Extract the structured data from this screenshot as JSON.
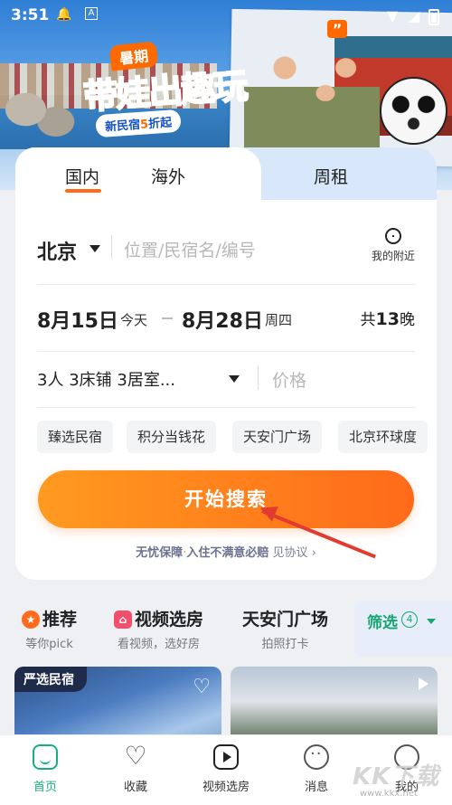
{
  "status": {
    "time": "3:51"
  },
  "banner": {
    "tag": "暑期",
    "title": "带娃出趣玩",
    "subtitle_prefix": "新民宿",
    "subtitle_highlight": "5",
    "subtitle_suffix": "折起"
  },
  "tabs": [
    {
      "label": "国内",
      "active": true
    },
    {
      "label": "海外",
      "active": false
    },
    {
      "label": "周租",
      "active": false
    }
  ],
  "search": {
    "city": "北京",
    "placeholder": "位置/民宿名/编号",
    "nearby_label": "我的附近",
    "checkin_date": "8月15日",
    "checkin_day": "今天",
    "checkout_date": "8月28日",
    "checkout_day": "周四",
    "nights_prefix": "共",
    "nights_count": "13",
    "nights_suffix": "晚",
    "guests": "3人",
    "beds": "3床铺",
    "rooms": "3居室...",
    "price_placeholder": "价格",
    "chips": [
      "臻选民宿",
      "积分当钱花",
      "天安门广场",
      "北京环球度"
    ],
    "button_label": "开始搜索",
    "guarantee_bold": "无忧保障",
    "guarantee_sep": "·",
    "guarantee_text": "入住不满意必赔",
    "guarantee_link": "见协议 ›"
  },
  "categories": [
    {
      "title": "推荐",
      "subtitle": "等你pick",
      "icon": "star-badge-icon",
      "icon_color": "#ff6b1a"
    },
    {
      "title": "视频选房",
      "subtitle": "看视频，选好房",
      "icon": "video-house-icon",
      "icon_color": "#f0506e"
    },
    {
      "title": "天安门广场",
      "subtitle": "拍照打卡"
    }
  ],
  "filter": {
    "label": "筛选",
    "count": "4"
  },
  "listings": [
    {
      "badge": "严选民宿",
      "icon": "heart-icon"
    },
    {
      "icon": "play-icon"
    }
  ],
  "nav": [
    {
      "label": "首页",
      "icon": "home-icon",
      "active": true
    },
    {
      "label": "收藏",
      "icon": "heart-icon"
    },
    {
      "label": "视频选房",
      "icon": "video-icon"
    },
    {
      "label": "消息",
      "icon": "message-icon"
    },
    {
      "label": "我的",
      "icon": "profile-icon"
    }
  ],
  "watermark": {
    "brand": "KK下载",
    "url": "www.kkx.net"
  },
  "colors": {
    "accent": "#ff6b1a",
    "brand_green": "#17a672",
    "promo_blue": "#1553c7"
  }
}
